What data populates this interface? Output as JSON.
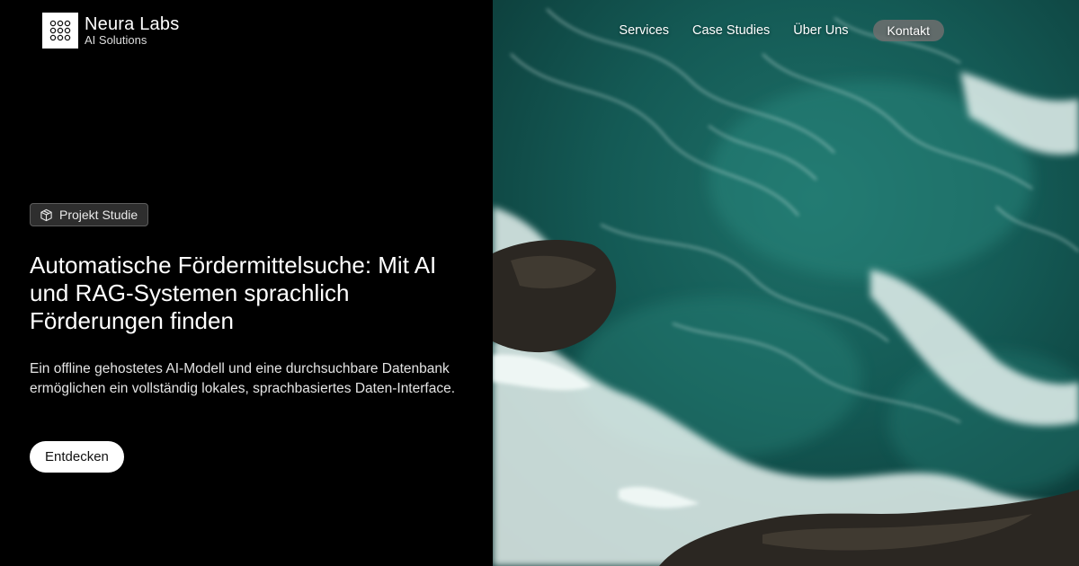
{
  "brand": {
    "name": "Neura Labs",
    "tagline": "AI Solutions"
  },
  "nav": {
    "items": [
      "Services",
      "Case Studies",
      "Über Uns"
    ],
    "contact_label": "Kontakt"
  },
  "hero": {
    "badge_label": "Projekt Studie",
    "headline": "Automatische Fördermittelsuche: Mit AI und RAG-Systemen sprachlich Förderungen finden",
    "lead": "Ein offline gehostetes AI-Modell und eine durchsuchbare Datenbank ermöglichen ein vollständig lokales, sprachbasiertes Daten-Interface.",
    "cta_label": "Entdecken"
  },
  "icons": {
    "badge": "cube-icon",
    "logo": "hexagon-grid-logo-icon"
  },
  "colors": {
    "background": "#000000",
    "badge_bg": "#2e2e2e",
    "contact_bg": "#6e6e6e",
    "ocean": "#0f3d3a"
  }
}
